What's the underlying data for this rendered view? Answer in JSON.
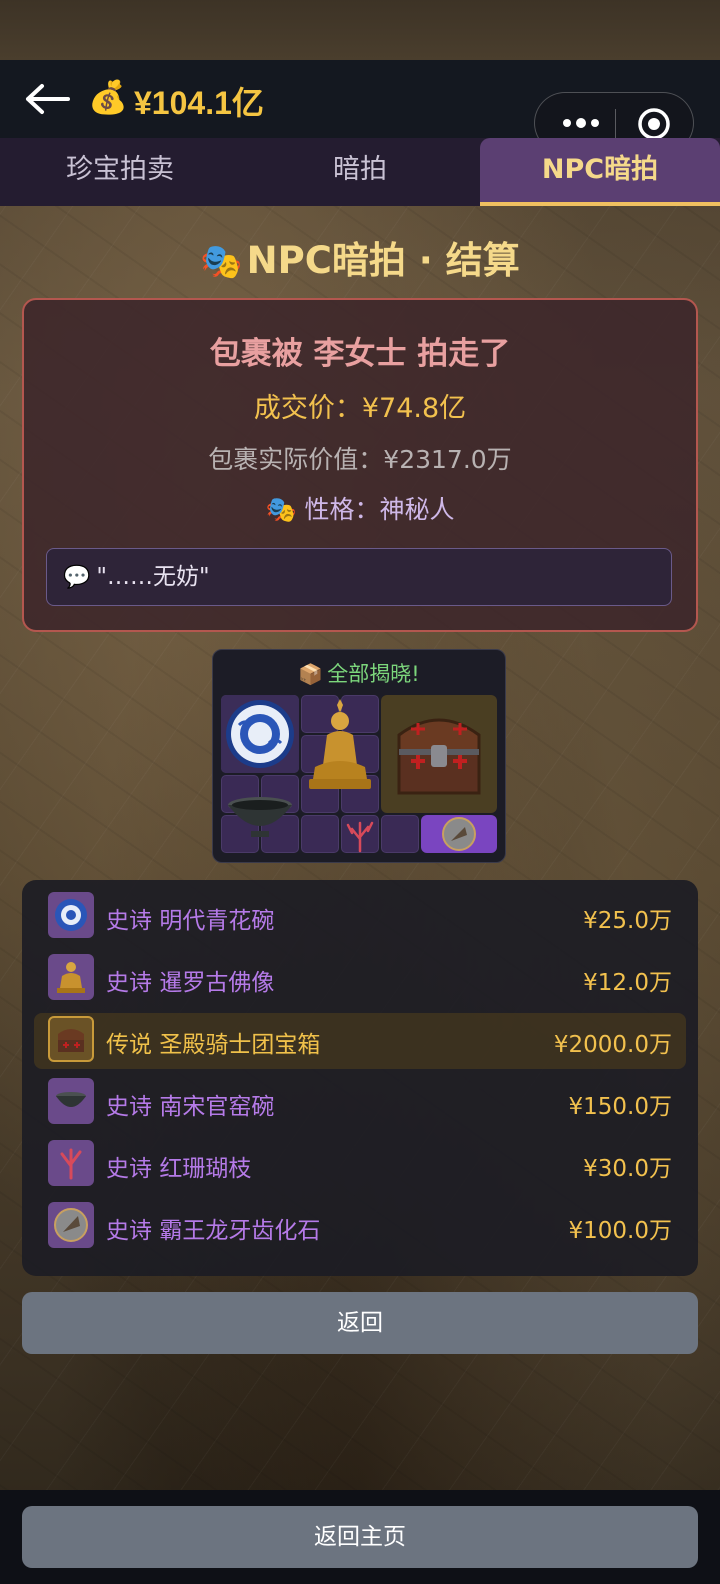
{
  "header": {
    "money_icon": "💰",
    "balance": "¥104.1亿"
  },
  "capsule": {
    "more_icon": "more-dots-icon",
    "close_icon": "target-circle-icon"
  },
  "tabs": [
    {
      "label": "珍宝拍卖",
      "active": false
    },
    {
      "label": "暗拍",
      "active": false
    },
    {
      "label": "NPC暗拍",
      "active": true
    }
  ],
  "page_title": {
    "icon": "🎭",
    "text": "NPC暗拍 · 结算"
  },
  "result": {
    "winner_text": "包裹被 李女士 拍走了",
    "deal_price": "成交价：¥74.8亿",
    "actual_value": "包裹实际价值：¥2317.0万",
    "trait_icon": "🎭",
    "trait": "性格：神秘人",
    "quote_icon": "💬",
    "quote": "\"……无妨\""
  },
  "reveal": {
    "icon": "📦",
    "label": "全部揭晓!"
  },
  "items": [
    {
      "rarity": "史诗",
      "name": "明代青花碗",
      "price": "¥25.0万",
      "tier": "epic",
      "icon": "blue-white-bowl-icon"
    },
    {
      "rarity": "史诗",
      "name": "暹罗古佛像",
      "price": "¥12.0万",
      "tier": "epic",
      "icon": "buddha-statue-icon"
    },
    {
      "rarity": "传说",
      "name": "圣殿骑士团宝箱",
      "price": "¥2000.0万",
      "tier": "legend",
      "icon": "treasure-chest-icon"
    },
    {
      "rarity": "史诗",
      "name": "南宋官窑碗",
      "price": "¥150.0万",
      "tier": "epic",
      "icon": "celadon-bowl-icon"
    },
    {
      "rarity": "史诗",
      "name": "红珊瑚枝",
      "price": "¥30.0万",
      "tier": "epic",
      "icon": "red-coral-icon"
    },
    {
      "rarity": "史诗",
      "name": "霸王龙牙齿化石",
      "price": "¥100.0万",
      "tier": "epic",
      "icon": "fossil-tooth-icon"
    }
  ],
  "buttons": {
    "back": "返回",
    "home": "返回主页"
  },
  "colors": {
    "gold": "#f5c542",
    "epic": "#b57ae8",
    "legend": "#f0c14a",
    "tab_active": "#5b3f72"
  }
}
